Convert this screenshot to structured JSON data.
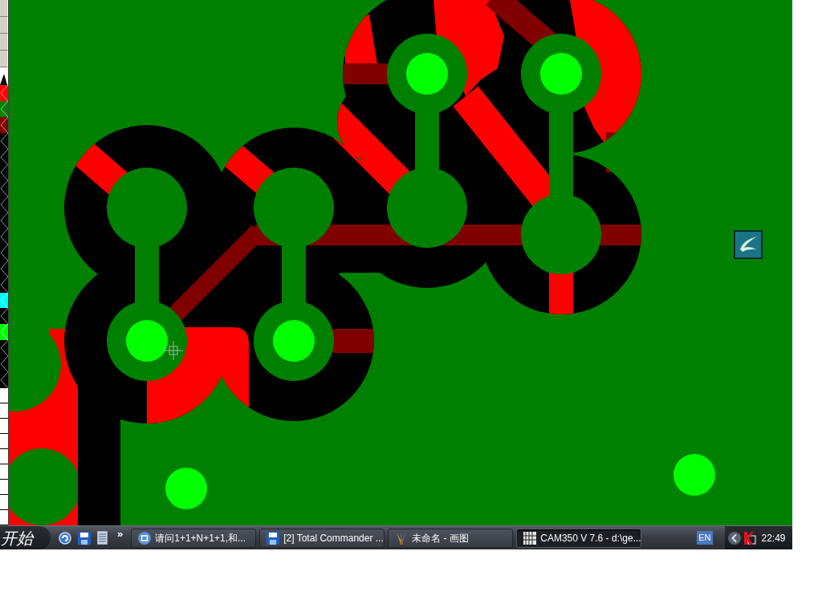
{
  "layer_panel": {
    "layers": [
      {
        "color": "#ff0000"
      },
      {
        "color": "#008000"
      },
      {
        "color": "#800000"
      },
      {
        "color": "#000000"
      },
      {
        "color": "#000000"
      },
      {
        "color": "#000000"
      },
      {
        "color": "#000000"
      },
      {
        "color": "#000000"
      },
      {
        "color": "#000000"
      },
      {
        "color": "#000000"
      },
      {
        "color": "#000000"
      },
      {
        "color": "#000000"
      },
      {
        "color": "#000000"
      },
      {
        "color": "#00ffff"
      },
      {
        "color": "#000000"
      },
      {
        "color": "#00ff00"
      },
      {
        "color": "#000000"
      },
      {
        "color": "#000000"
      },
      {
        "color": "#000000"
      }
    ]
  },
  "taskbar": {
    "start_button": "开始",
    "more": "»",
    "tasks": [
      {
        "label": "请问1+1+N+1+1,和...",
        "selected": false
      },
      {
        "label": "[2] Total Commander ...",
        "selected": false
      },
      {
        "label": "未命名 - 画图",
        "selected": false
      },
      {
        "label": "CAM350 V 7.6 - d:\\ge...",
        "selected": true
      }
    ],
    "tray": {
      "language": "EN",
      "clock": "22:49"
    }
  }
}
